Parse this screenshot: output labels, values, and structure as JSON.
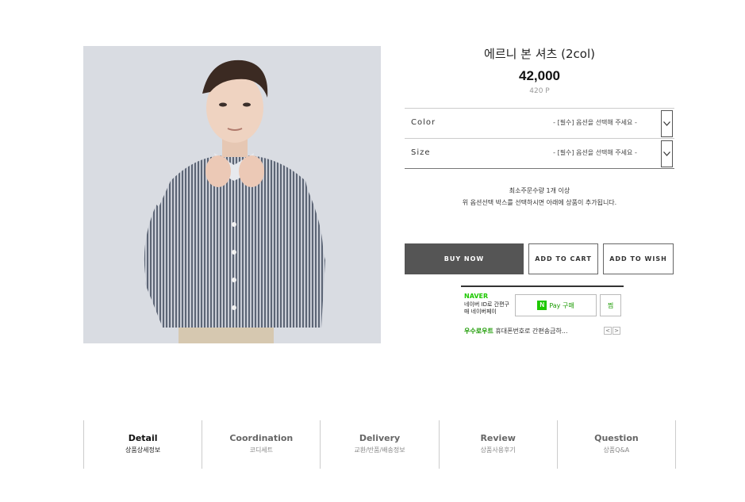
{
  "product": {
    "title": "에르니 본 셔츠 (2col)",
    "price": "42,000",
    "points": "420 P"
  },
  "options": [
    {
      "label": "Color",
      "selected": "- [필수] 옵션을 선택해 주세요 -"
    },
    {
      "label": "Size",
      "selected": "- [필수] 옵션을 선택해 주세요 -"
    }
  ],
  "notice": {
    "min_qty": "최소주문수량 1개 이상",
    "hint": "위 옵션선택 박스를 선택하시면 아래에 상품이 추가됩니다."
  },
  "buttons": {
    "buy_now": "BUY NOW",
    "add_to_cart": "ADD TO CART",
    "add_to_wish": "ADD TO WISH"
  },
  "naver_pay": {
    "brand": "NAVER",
    "desc": "네이버 ID로 간편구매 네이버페이",
    "pay_label": "Pay 구매",
    "n_mark": "N",
    "jjim": "찜",
    "promo_highlight": "우수로우트",
    "promo_text": "휴대폰번호로 간편송금하...",
    "prev": "<",
    "next": ">"
  },
  "tabs": [
    {
      "en": "Detail",
      "ko": "상품상세정보",
      "active": true
    },
    {
      "en": "Coordination",
      "ko": "코디세트",
      "active": false
    },
    {
      "en": "Delivery",
      "ko": "교환/반품/배송정보",
      "active": false
    },
    {
      "en": "Review",
      "ko": "상품사용후기",
      "active": false
    },
    {
      "en": "Question",
      "ko": "상품Q&A",
      "active": false
    }
  ],
  "colors": {
    "buy_button_bg": "#555555",
    "naver_green": "#1ec800",
    "shirt_stripe": "#5c6575"
  },
  "image": {
    "icon": "product-photo-model-striped-shirt"
  }
}
